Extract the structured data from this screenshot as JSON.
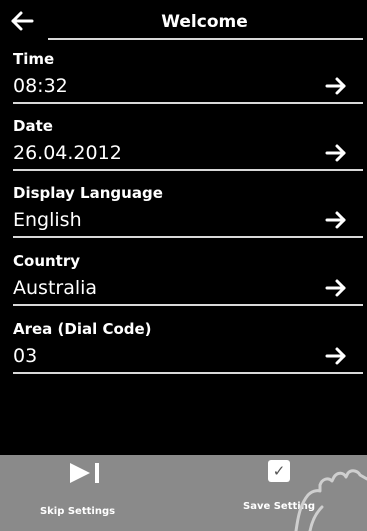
{
  "header": {
    "title": "Welcome"
  },
  "settings": [
    {
      "label": "Time",
      "value": "08:32"
    },
    {
      "label": "Date",
      "value": "26.04.2012"
    },
    {
      "label": "Display Language",
      "value": "English"
    },
    {
      "label": "Country",
      "value": "Australia"
    },
    {
      "label": "Area (Dial Code)",
      "value": "03"
    }
  ],
  "footer": {
    "skip_label": "Skip Settings",
    "save_label": "Save Setting",
    "save_icon": "checkbox-check-icon",
    "skip_icon": "skip-forward-icon"
  },
  "colors": {
    "background": "#000000",
    "footer": "#8a8a8a",
    "text": "#ffffff"
  }
}
